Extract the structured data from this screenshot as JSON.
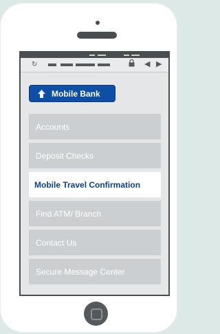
{
  "colors": {
    "background": "#dde9e6",
    "phone_body": "#ffffff",
    "dark_trim": "#4a4d4f",
    "brand_blue": "#0d4ea6",
    "menu_gray": "#cccfd1",
    "active_text": "#0d3f8f"
  },
  "browser": {
    "reload_icon": "reload-icon",
    "lock_icon": "lock-icon",
    "back_icon": "back-arrow-icon",
    "forward_icon": "forward-arrow-icon"
  },
  "header": {
    "mobile_bank_label": "Mobile Bank",
    "icon": "home-icon"
  },
  "menu": {
    "items": [
      {
        "label": "Accounts",
        "active": false
      },
      {
        "label": "Deposit Checks",
        "active": false
      },
      {
        "label": "Mobile Travel Confirmation",
        "active": true
      },
      {
        "label": "Find ATM/ Branch",
        "active": false
      },
      {
        "label": "Contact Us",
        "active": false
      },
      {
        "label": "Secure Message Center",
        "active": false
      }
    ]
  }
}
